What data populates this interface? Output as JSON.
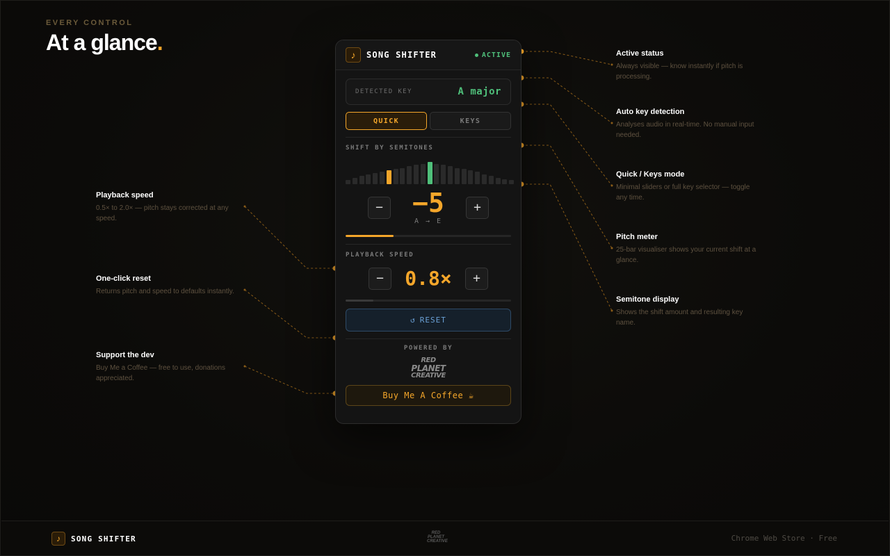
{
  "hero": {
    "eyebrow": "EVERY CONTROL",
    "headline": "At a glance",
    "headline_dot": "."
  },
  "callouts_left": [
    {
      "title": "Playback speed",
      "desc": "0.5× to 2.0× — pitch stays corrected at any speed."
    },
    {
      "title": "One-click reset",
      "desc": "Returns pitch and speed to defaults instantly."
    },
    {
      "title": "Support the dev",
      "desc": "Buy Me a Coffee — free to use, donations appreciated."
    }
  ],
  "callouts_right": [
    {
      "title": "Active status",
      "desc": "Always visible — know instantly if pitch is processing."
    },
    {
      "title": "Auto key detection",
      "desc": "Analyses audio in real-time. No manual input needed."
    },
    {
      "title": "Quick / Keys mode",
      "desc": "Minimal sliders or full key selector — toggle any time."
    },
    {
      "title": "Pitch meter",
      "desc": "25-bar visualiser shows your current shift at a glance."
    },
    {
      "title": "Semitone display",
      "desc": "Shows the shift amount and resulting key name."
    }
  ],
  "panel": {
    "icon": "♪",
    "title": "SONG SHIFTER",
    "status": "ACTIVE",
    "detected_key_label": "DETECTED KEY",
    "detected_key": "A major",
    "tabs": [
      {
        "label": "QUICK",
        "active": true
      },
      {
        "label": "KEYS",
        "active": false
      }
    ],
    "shift_label": "SHIFT BY SEMITONES",
    "minus": "−",
    "plus": "+",
    "semitone_value": "−5",
    "semitone_keys": "A → E",
    "semitone_progress": 0.29,
    "meter": {
      "bar_count": 25,
      "current_index": 6,
      "center_index": 12,
      "heights": [
        0.18,
        0.27,
        0.36,
        0.45,
        0.5,
        0.55,
        0.64,
        0.68,
        0.73,
        0.82,
        0.86,
        0.91,
        1.0,
        0.91,
        0.86,
        0.82,
        0.73,
        0.68,
        0.64,
        0.55,
        0.45,
        0.36,
        0.27,
        0.23,
        0.18
      ]
    },
    "speed_label": "PLAYBACK SPEED",
    "speed_value": "0.8×",
    "speed_progress": 0.17,
    "reset_icon": "↺",
    "reset_label": "RESET",
    "powered_by": "POWERED BY",
    "logo_lines": [
      "RED",
      "PLANET",
      "CREATIVE"
    ],
    "coffee_label": "Buy Me A Coffee ☕"
  },
  "footer": {
    "icon": "♪",
    "title": "SONG SHIFTER",
    "logo_lines": [
      "RED",
      "PLANET",
      "CREATIVE"
    ],
    "store": "Chrome Web Store · Free"
  },
  "colors": {
    "accent": "#f4a62a",
    "green": "#4fbf7a",
    "blue": "#6aa0d6",
    "bar_idle": "#2a2a2a"
  }
}
